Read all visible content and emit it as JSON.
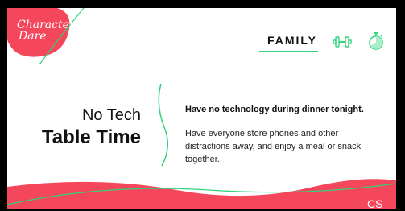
{
  "brand": {
    "logo_line1": "Character",
    "logo_line2": "Dare"
  },
  "nav": {
    "tab_label": "FAMILY"
  },
  "icons": {
    "fitness": "dumbbell-icon",
    "timer": "stopwatch-icon"
  },
  "dare": {
    "title_light": "No Tech",
    "title_bold": "Table Time",
    "headline": "Have no technology during dinner tonight.",
    "body": "Have everyone store phones and other distractions away, and enjoy a meal or snack together."
  },
  "footer": {
    "corner_text": "CS"
  },
  "colors": {
    "accent_red": "#f4475c",
    "accent_green": "#2fd47c",
    "icon_green": "#2fd47c"
  }
}
